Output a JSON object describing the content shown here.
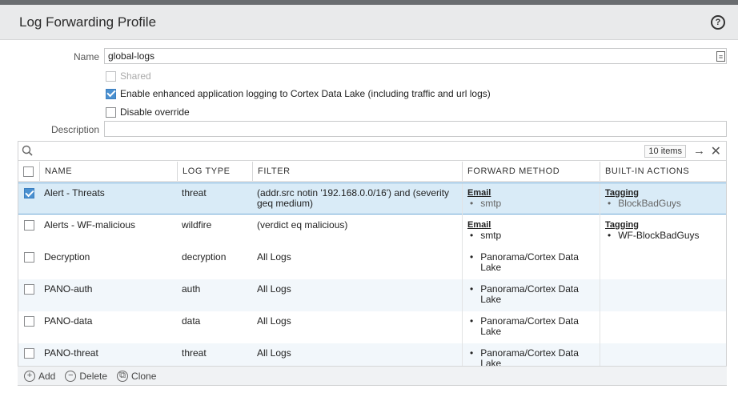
{
  "header": {
    "title": "Log Forwarding Profile",
    "help_glyph": "?"
  },
  "form": {
    "name_label": "Name",
    "name_value": "global-logs",
    "shared_label": "Shared",
    "enhanced_label": "Enable enhanced application logging to Cortex Data Lake (including traffic and url logs)",
    "disable_override_label": "Disable override",
    "description_label": "Description",
    "description_value": ""
  },
  "toolbar": {
    "items_count": "10 items",
    "go_glyph": "→",
    "clear_glyph": "✕"
  },
  "table": {
    "columns": [
      "NAME",
      "LOG TYPE",
      "FILTER",
      "FORWARD METHOD",
      "BUILT-IN ACTIONS"
    ],
    "rows": [
      {
        "name": "Alert - Threats",
        "log_type": "threat",
        "filter": "(addr.src notin '192.168.0.0/16') and (severity geq medium)",
        "forward_header": "Email",
        "forward_item": "smtp",
        "action_header": "Tagging",
        "action_item": "BlockBadGuys",
        "checked": true
      },
      {
        "name": "Alerts - WF-malicious",
        "log_type": "wildfire",
        "filter": "(verdict eq malicious)",
        "forward_header": "Email",
        "forward_item": "smtp",
        "action_header": "Tagging",
        "action_item": "WF-BlockBadGuys",
        "checked": false
      },
      {
        "name": "Decryption",
        "log_type": "decryption",
        "filter": "All Logs",
        "forward_header": "",
        "forward_item": "Panorama/Cortex Data Lake",
        "action_header": "",
        "action_item": "",
        "checked": false
      },
      {
        "name": "PANO-auth",
        "log_type": "auth",
        "filter": "All Logs",
        "forward_header": "",
        "forward_item": "Panorama/Cortex Data Lake",
        "action_header": "",
        "action_item": "",
        "checked": false
      },
      {
        "name": "PANO-data",
        "log_type": "data",
        "filter": "All Logs",
        "forward_header": "",
        "forward_item": "Panorama/Cortex Data Lake",
        "action_header": "",
        "action_item": "",
        "checked": false
      },
      {
        "name": "PANO-threat",
        "log_type": "threat",
        "filter": "All Logs",
        "forward_header": "",
        "forward_item": "Panorama/Cortex Data Lake",
        "action_header": "",
        "action_item": "",
        "checked": false
      }
    ]
  },
  "bottom_bar": {
    "add_label": "Add",
    "delete_label": "Delete",
    "clone_label": "Clone"
  },
  "colors": {
    "accent": "#4a90d0",
    "selected_row": "#d9ebf7",
    "title_bar": "#e9eaeb"
  }
}
